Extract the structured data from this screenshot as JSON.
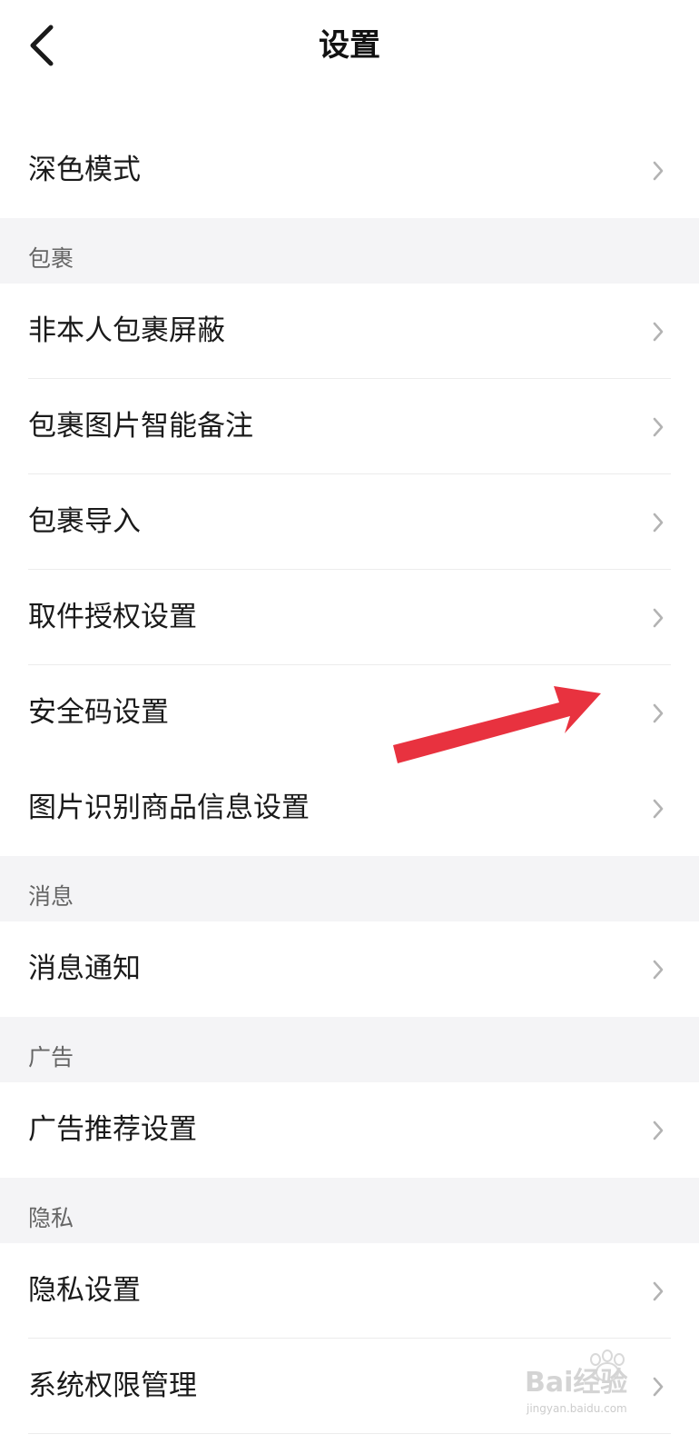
{
  "header": {
    "title": "设置",
    "back_icon": "chevron-left-icon"
  },
  "top_items": [
    {
      "label": "深色模式"
    }
  ],
  "sections": [
    {
      "title": "包裹",
      "items": [
        {
          "label": "非本人包裹屏蔽"
        },
        {
          "label": "包裹图片智能备注"
        },
        {
          "label": "包裹导入"
        },
        {
          "label": "取件授权设置"
        },
        {
          "label": "安全码设置"
        },
        {
          "label": "图片识别商品信息设置"
        }
      ]
    },
    {
      "title": "消息",
      "items": [
        {
          "label": "消息通知"
        }
      ]
    },
    {
      "title": "广告",
      "items": [
        {
          "label": "广告推荐设置"
        }
      ]
    },
    {
      "title": "隐私",
      "items": [
        {
          "label": "隐私设置"
        },
        {
          "label": "系统权限管理"
        }
      ]
    }
  ],
  "row_icon": "chevron-right-icon",
  "annotation": {
    "icon": "red-arrow-annotation",
    "color": "#e8323f"
  },
  "watermark": {
    "text": "Bai经验",
    "subtext": "jingyan.baidu.com"
  },
  "colors": {
    "background": "#ffffff",
    "section_bg": "#f4f4f6",
    "text_primary": "#1a1a1a",
    "text_secondary": "#666666",
    "chevron": "#b3b3b3",
    "divider": "#ececec"
  }
}
